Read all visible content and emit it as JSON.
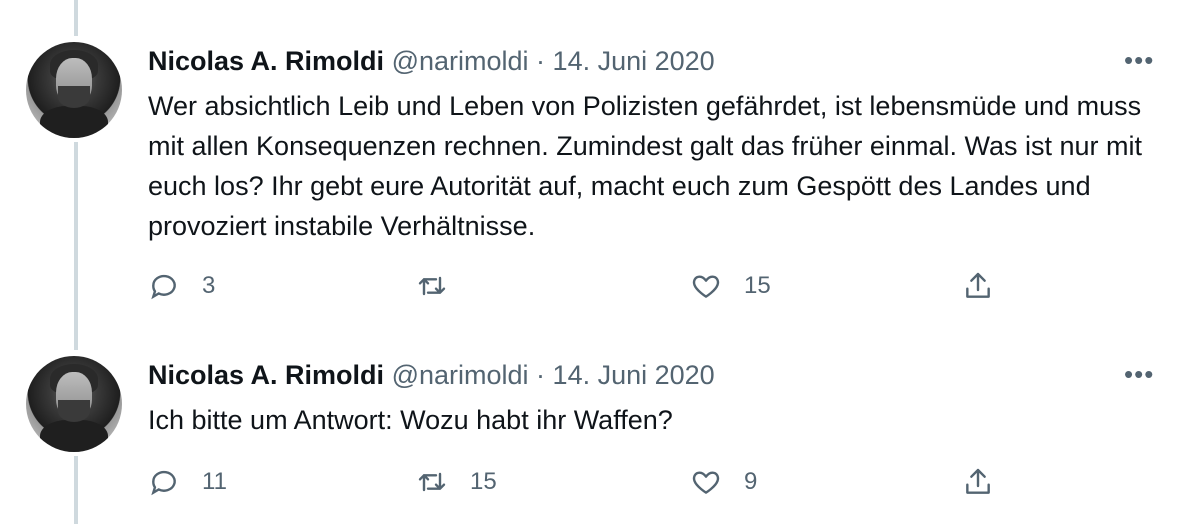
{
  "tweets": [
    {
      "author_name": "Nicolas A. Rimoldi",
      "handle": "@narimoldi",
      "separator": "·",
      "date": "14. Juni 2020",
      "more_label": "•••",
      "text": "Wer absichtlich Leib und Leben von Polizisten gefährdet, ist lebensmüde und muss mit allen Konsequenzen rechnen. Zumindest galt das früher einmal. Was ist nur mit euch los? Ihr gebt eure Autorität auf, macht euch zum Gespött des Landes und provoziert instabile Verhältnisse.",
      "replies": "3",
      "retweets": "",
      "likes": "15"
    },
    {
      "author_name": "Nicolas A. Rimoldi",
      "handle": "@narimoldi",
      "separator": "·",
      "date": "14. Juni 2020",
      "more_label": "•••",
      "text": "Ich bitte um Antwort: Wozu habt ihr Waffen?",
      "replies": "11",
      "retweets": "15",
      "likes": "9"
    }
  ],
  "icons": [
    "reply-icon",
    "retweet-icon",
    "like-icon",
    "share-icon",
    "more-icon"
  ],
  "colors": {
    "text": "#0f1419",
    "secondary": "#536471",
    "thread_line": "#cfd9de"
  }
}
